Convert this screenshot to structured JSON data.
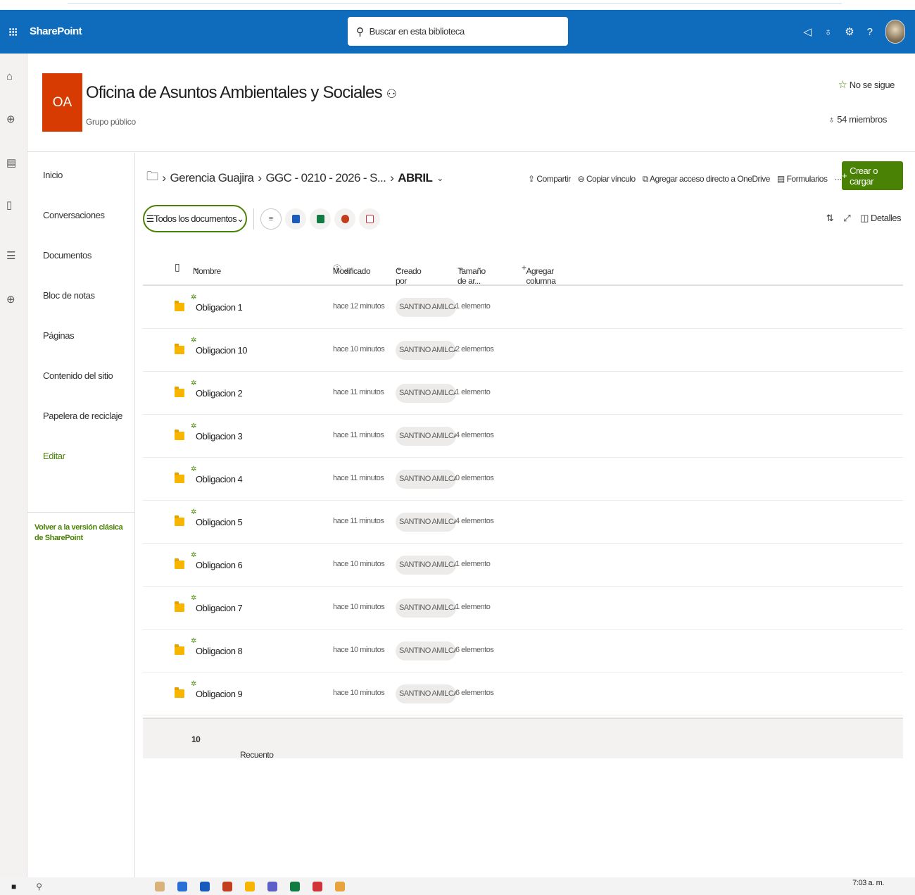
{
  "suitebar": {
    "waffle": "⁝⁝⁝",
    "brand": "SharePoint",
    "search_placeholder": "Buscar en esta biblioteca",
    "icons": [
      "megaphone-icon",
      "share-icon",
      "settings-icon",
      "help-icon",
      "avatar"
    ],
    "help_glyph": "?"
  },
  "site": {
    "logo_initials": "OA",
    "title": "Oficina de Asuntos Ambientales y Sociales",
    "subtitle": "Grupo público",
    "follow": "No se sigue",
    "members": "54 miembros"
  },
  "nav": {
    "items": [
      "Inicio",
      "Conversaciones",
      "Documentos",
      "Bloc de notas",
      "Páginas",
      "Contenido del sitio",
      "Papelera de reciclaje"
    ],
    "edit": "Editar",
    "classic_link": "Volver a la versión clásica de SharePoint"
  },
  "breadcrumb": {
    "items": [
      "Gerencia Guajira",
      "GGC - 0210 - 2026 - S..."
    ],
    "current": "ABRIL"
  },
  "commands": {
    "share": "Compartir",
    "copy_link": "Copiar vínculo",
    "shortcut": "Agregar acceso directo a OneDrive",
    "forms": "Formularios",
    "more": "···",
    "new": "Crear o cargar"
  },
  "view": {
    "name": "Todos los documentos",
    "details": "Detalles"
  },
  "columns": {
    "name": "Nombre",
    "modified": "Modificado",
    "created_by": "Creado por",
    "size": "Tamaño de ar...",
    "add": "Agregar columna"
  },
  "rows": [
    {
      "name": "Obligacion 1",
      "modified": "hace 12 minutos",
      "created_by": "SANTINO AMILCAR F",
      "size": "1 elemento"
    },
    {
      "name": "Obligacion 10",
      "modified": "hace 10 minutos",
      "created_by": "SANTINO AMILCAR F",
      "size": "2 elementos"
    },
    {
      "name": "Obligacion 2",
      "modified": "hace 11 minutos",
      "created_by": "SANTINO AMILCAR F",
      "size": "1 elemento"
    },
    {
      "name": "Obligacion 3",
      "modified": "hace 11 minutos",
      "created_by": "SANTINO AMILCAR F",
      "size": "4 elementos"
    },
    {
      "name": "Obligacion 4",
      "modified": "hace 11 minutos",
      "created_by": "SANTINO AMILCAR F",
      "size": "0 elementos"
    },
    {
      "name": "Obligacion 5",
      "modified": "hace 11 minutos",
      "created_by": "SANTINO AMILCAR F",
      "size": "4 elementos"
    },
    {
      "name": "Obligacion 6",
      "modified": "hace 10 minutos",
      "created_by": "SANTINO AMILCAR F",
      "size": "1 elemento"
    },
    {
      "name": "Obligacion 7",
      "modified": "hace 10 minutos",
      "created_by": "SANTINO AMILCAR F",
      "size": "1 elemento"
    },
    {
      "name": "Obligacion 8",
      "modified": "hace 10 minutos",
      "created_by": "SANTINO AMILCAR F",
      "size": "6 elementos"
    },
    {
      "name": "Obligacion 9",
      "modified": "hace 10 minutos",
      "created_by": "SANTINO AMILCAR F",
      "size": "6 elementos"
    }
  ],
  "footer": {
    "label": "Recuento",
    "count": "10"
  },
  "taskbar": {
    "clock": "7:03 a. m."
  },
  "colors": {
    "suitebar": "#0f6cbd",
    "accent": "#498205",
    "logo": "#d83b01",
    "folder": "#f7b500"
  }
}
